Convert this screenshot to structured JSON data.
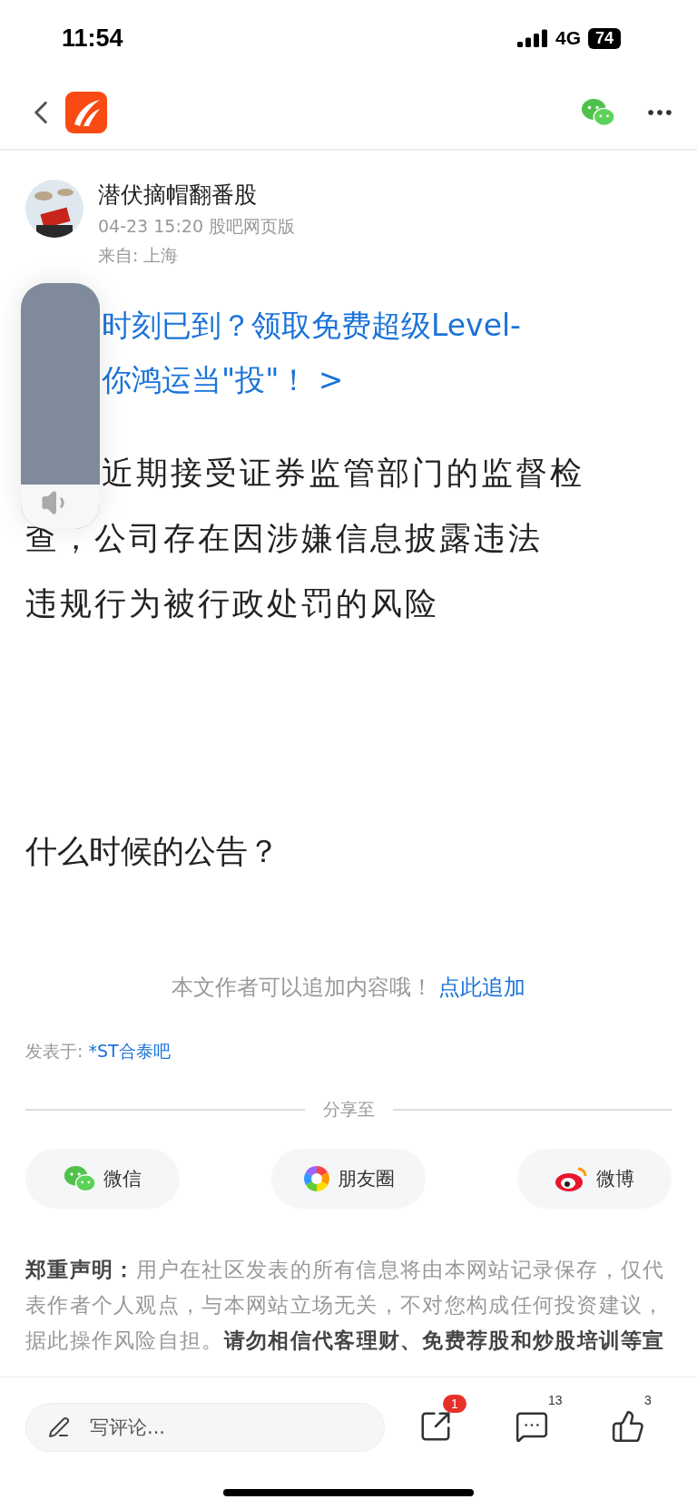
{
  "status_bar": {
    "time": "11:54",
    "network": "4G",
    "battery": "74"
  },
  "post": {
    "author": "潜伏摘帽翻番股",
    "meta": "04-23 15:20 股吧网页版",
    "location": "来自: 上海",
    "promo_lines": [
      "时刻已到？领取免费超级Level-",
      "你鸿运当\"投\"！ >"
    ],
    "body_lines": [
      "近期接受证券监管部门的监督检",
      "查，公司存在因涉嫌信息披露违法",
      "违规行为被行政处罚的风险"
    ],
    "question": "什么时候的公告？"
  },
  "append": {
    "text": "本文作者可以追加内容哦！",
    "link": "点此追加"
  },
  "posted_in": {
    "label": "发表于:",
    "forum": "*ST合泰吧"
  },
  "share": {
    "title": "分享至",
    "targets": [
      {
        "kind": "wechat",
        "label": "微信"
      },
      {
        "kind": "moments",
        "label": "朋友圈"
      },
      {
        "kind": "weibo",
        "label": "微博"
      }
    ]
  },
  "disclaimer": "**郑重声明：**用户在社区发表的所有信息将由本网站记录保存，仅代表作者个人观点，与本网站立场无关，不对您构成任何投资建议，据此操作风险自担。**请勿相信代客理财、免费荐股和炒股培训等宣**",
  "bottom_bar": {
    "placeholder": "写评论...",
    "actions": [
      {
        "kind": "share",
        "badge": "1"
      },
      {
        "kind": "comment",
        "count": "13"
      },
      {
        "kind": "like",
        "count": "3"
      }
    ]
  },
  "volume": {
    "level": 0.18
  }
}
